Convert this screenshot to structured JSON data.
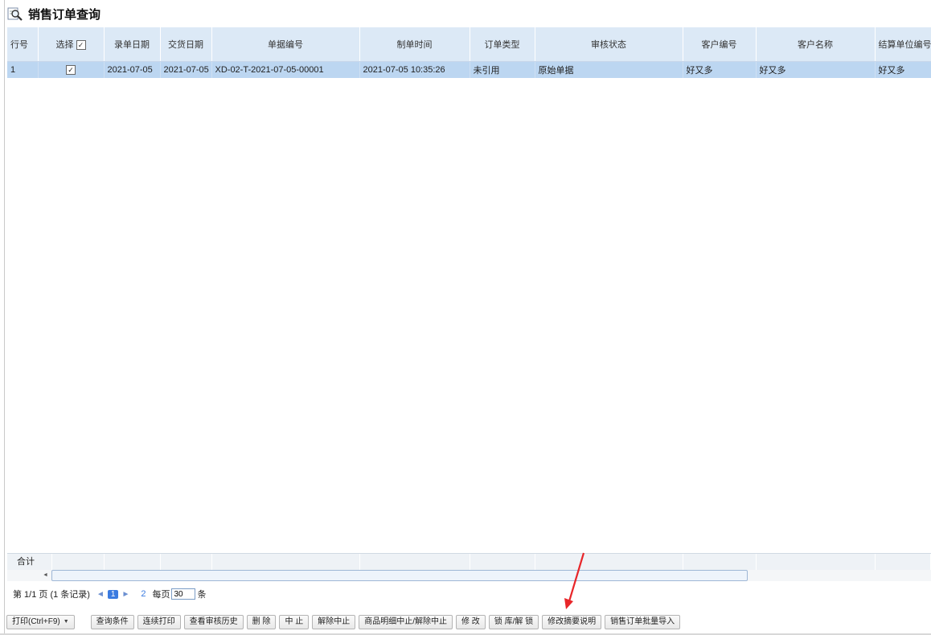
{
  "window": {
    "title": "销售订单查询"
  },
  "grid": {
    "columns": [
      "行号",
      "选择",
      "录单日期",
      "交货日期",
      "单据编号",
      "制单时间",
      "订单类型",
      "审核状态",
      "客户编号",
      "客户名称",
      "结算单位编号"
    ],
    "rows": [
      {
        "row_no": "1",
        "selected": true,
        "entry_date": "2021-07-05",
        "delivery_date": "2021-07-05",
        "doc_no": "XD-02-T-2021-07-05-00001",
        "created_time": "2021-07-05 10:35:26",
        "order_type": "未引用",
        "audit_status": "原始单据",
        "customer_code": "好又多",
        "customer_name": "好又多",
        "settlement_code": "好又多"
      }
    ],
    "total_label": "合计"
  },
  "pager": {
    "page_info": "第 1/1 页 (1 条记录)",
    "prev": "◄",
    "current_page": "1",
    "next": "►",
    "next_link": "2",
    "per_page_label": "每页",
    "per_page_value": "30",
    "per_page_unit": "条"
  },
  "toolbar": {
    "print": "打印(Ctrl+F9)",
    "buttons": [
      "查询条件",
      "连续打印",
      "查看审核历史",
      "删 除",
      "中 止",
      "解除中止",
      "商品明细中止/解除中止",
      "修 改",
      "锁 库/解 锁",
      "修改摘要说明",
      "销售订单批量导入"
    ]
  },
  "colors": {
    "header_bg": "#dce9f6",
    "selected_row": "#bcd6f1",
    "accent": "#3b7be0",
    "arrow": "#e8262a"
  }
}
